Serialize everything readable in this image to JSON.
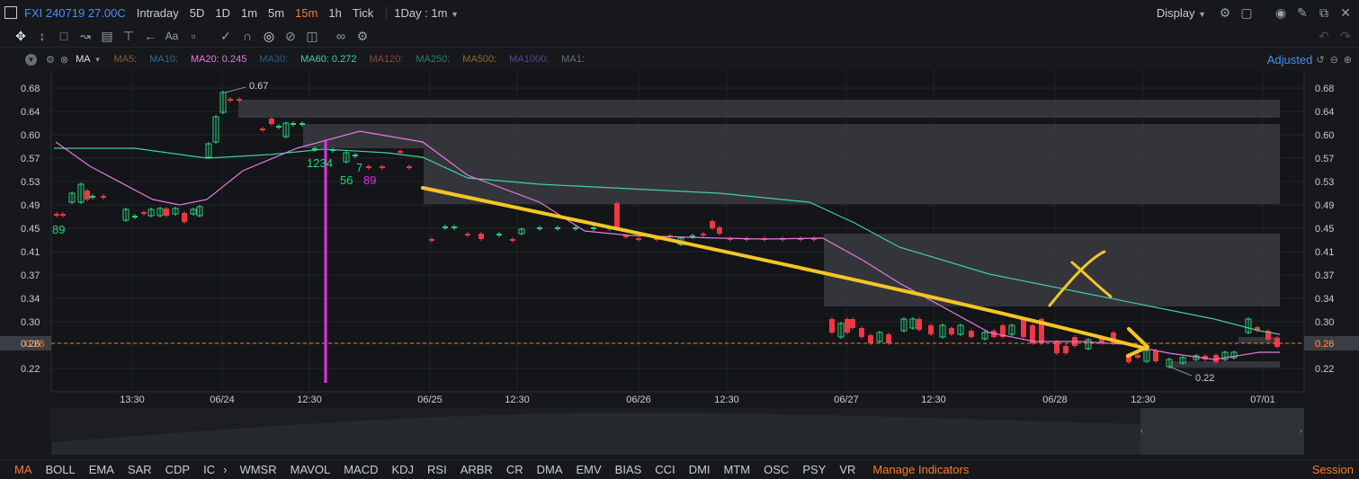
{
  "header": {
    "symbol": "FXI 240719 27.00C",
    "timeframes": [
      "Intraday",
      "5D",
      "1D",
      "1m",
      "5m",
      "15m",
      "1h",
      "Tick"
    ],
    "active_timeframe": "15m",
    "range_select": "1Day : 1m",
    "display_label": "Display"
  },
  "toolbar": {
    "tools": [
      "move-cross",
      "cursor",
      "rect-select",
      "trend",
      "indicator",
      "fib",
      "arrow-back",
      "text-aa",
      "comment",
      "pen",
      "magnet",
      "eye",
      "hide",
      "trash",
      "link",
      "settings"
    ]
  },
  "ma_bar": {
    "name": "MA",
    "items": [
      {
        "label": "MA5:",
        "value": "",
        "color": "#8b5a3c"
      },
      {
        "label": "MA10:",
        "value": "",
        "color": "#2c6f8c"
      },
      {
        "label": "MA20:",
        "value": "0.245",
        "color": "#e879e0"
      },
      {
        "label": "MA30:",
        "value": "",
        "color": "#2f5b8e"
      },
      {
        "label": "MA60:",
        "value": "0.272",
        "color": "#3ed29a"
      },
      {
        "label": "MA120:",
        "value": "",
        "color": "#8c4a43"
      },
      {
        "label": "MA250:",
        "value": "",
        "color": "#2d7c73"
      },
      {
        "label": "MA500:",
        "value": "",
        "color": "#8a6a2c"
      },
      {
        "label": "MA1000:",
        "value": "",
        "color": "#5a4690"
      },
      {
        "label": "MA1:",
        "value": "",
        "color": "#6b6f75"
      }
    ],
    "adjusted_label": "Adjusted"
  },
  "chart_data": {
    "type": "candlestick",
    "y_ticks": [
      "0.68",
      "0.64",
      "0.60",
      "0.57",
      "0.53",
      "0.49",
      "0.45",
      "0.41",
      "0.37",
      "0.34",
      "0.30",
      "0.26",
      "0.22"
    ],
    "x_ticks": [
      "13:30",
      "06/24",
      "12:30",
      "06/25",
      "12:30",
      "06/26",
      "12:30",
      "06/27",
      "12:30",
      "06/28",
      "12:30",
      "07/01"
    ],
    "current_price": "0.26",
    "high_label": "0.67",
    "low_label": "0.22",
    "td_marks": [
      "89",
      "1234",
      "7",
      "56",
      "89"
    ],
    "colors": {
      "up": "#2dd17c",
      "down": "#f23645",
      "ma20": "#e879e0",
      "ma60": "#3ed29a",
      "annotation": "#f6c624",
      "price_line": "#ff7a29"
    }
  },
  "bottom": {
    "indicators": [
      "MA",
      "BOLL",
      "EMA",
      "SAR",
      "CDP",
      "IC",
      "WMSR",
      "MAVOL",
      "MACD",
      "KDJ",
      "RSI",
      "ARBR",
      "CR",
      "DMA",
      "EMV",
      "BIAS",
      "CCI",
      "DMI",
      "MTM",
      "OSC",
      "PSY",
      "VR"
    ],
    "manage": "Manage Indicators",
    "session": "Session"
  }
}
